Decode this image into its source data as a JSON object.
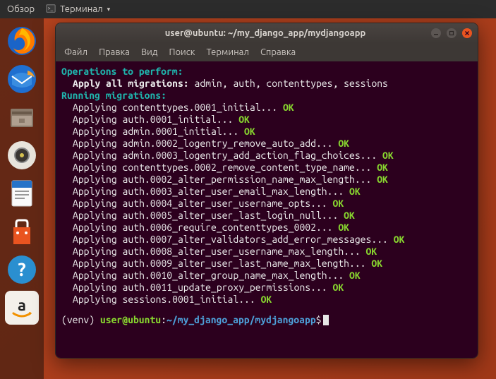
{
  "topbar": {
    "overview": "Обзор",
    "app_name": "Терминал"
  },
  "launcher": {
    "items": [
      {
        "name": "firefox-icon"
      },
      {
        "name": "thunderbird-icon"
      },
      {
        "name": "files-icon"
      },
      {
        "name": "rhythmbox-icon"
      },
      {
        "name": "writer-icon"
      },
      {
        "name": "software-icon"
      },
      {
        "name": "help-icon"
      },
      {
        "name": "amazon-icon"
      }
    ]
  },
  "window": {
    "title": "user@ubuntu: ~/my_django_app/mydjangoapp"
  },
  "menu": {
    "file": "Файл",
    "edit": "Правка",
    "view": "Вид",
    "search": "Поиск",
    "terminal": "Терминал",
    "help": "Справка"
  },
  "terminal": {
    "header1": "Operations to perform:",
    "apply_label": "Apply all migrations:",
    "apply_targets": " admin, auth, contenttypes, sessions",
    "header2": "Running migrations:",
    "applying_word": "Applying",
    "ok": "OK",
    "migrations": [
      "contenttypes.0001_initial",
      "auth.0001_initial",
      "admin.0001_initial",
      "admin.0002_logentry_remove_auto_add",
      "admin.0003_logentry_add_action_flag_choices",
      "contenttypes.0002_remove_content_type_name",
      "auth.0002_alter_permission_name_max_length",
      "auth.0003_alter_user_email_max_length",
      "auth.0004_alter_user_username_opts",
      "auth.0005_alter_user_last_login_null",
      "auth.0006_require_contenttypes_0002",
      "auth.0007_alter_validators_add_error_messages",
      "auth.0008_alter_user_username_max_length",
      "auth.0009_alter_user_last_name_max_length",
      "auth.0010_alter_group_name_max_length",
      "auth.0011_update_proxy_permissions",
      "sessions.0001_initial"
    ],
    "prompt": {
      "venv": "(venv) ",
      "user": "user@ubuntu",
      "colon": ":",
      "path": "~/my_django_app/mydjangoapp",
      "dollar": "$"
    }
  }
}
